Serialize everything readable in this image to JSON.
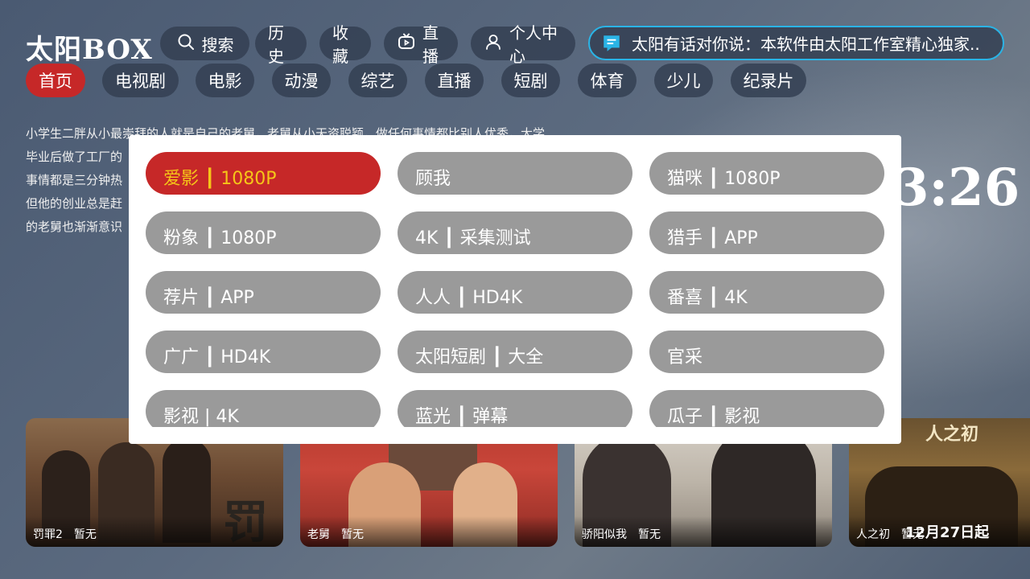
{
  "app": {
    "title": "太阳BOX"
  },
  "toolbar": {
    "search_label": "搜索",
    "history_label": "历史",
    "favorites_label": "收藏",
    "live_label": "直播",
    "profile_label": "个人中心"
  },
  "notice": {
    "text": "太阳有话对你说：本软件由太阳工作室精心独家.."
  },
  "tabs": [
    {
      "label": "首页"
    },
    {
      "label": "电视剧"
    },
    {
      "label": "电影"
    },
    {
      "label": "动漫"
    },
    {
      "label": "综艺"
    },
    {
      "label": "直播"
    },
    {
      "label": "短剧"
    },
    {
      "label": "体育"
    },
    {
      "label": "少儿"
    },
    {
      "label": "纪录片"
    }
  ],
  "description": {
    "lines": [
      "小学生二胖从小最崇拜的人就是自己的老舅，老舅从小天资聪颖，做任何事情都比别人优秀，大学",
      "毕业后做了工厂的",
      "事情都是三分钟热",
      "但他的创业总是赶",
      "的老舅也渐渐意识"
    ]
  },
  "clock": {
    "text": "3:26"
  },
  "source_dialog": {
    "items": [
      {
        "label": "爱影 ┃ 1080P"
      },
      {
        "label": "顾我"
      },
      {
        "label": "猫咪 ┃ 1080P"
      },
      {
        "label": "粉象 ┃ 1080P"
      },
      {
        "label": "4K ┃ 采集测试"
      },
      {
        "label": "猎手 ┃ APP"
      },
      {
        "label": "荐片 ┃ APP"
      },
      {
        "label": "人人 ┃ HD4K"
      },
      {
        "label": "番喜 ┃ 4K"
      },
      {
        "label": "广广 ┃ HD4K"
      },
      {
        "label": "太阳短剧 ┃ 大全"
      },
      {
        "label": "官采"
      },
      {
        "label": "影视 | 4K"
      },
      {
        "label": "蓝光 ┃ 弹幕"
      },
      {
        "label": "瓜子 ┃ 影视"
      }
    ],
    "selected_color": "#c62828",
    "selected_text_color": "#f5c518"
  },
  "cards": [
    {
      "title": "罚罪2",
      "status": "暂无"
    },
    {
      "title": "老舅",
      "status": "暂无"
    },
    {
      "title": "骄阳似我",
      "status": "暂无"
    },
    {
      "title": "人之初",
      "status": "暂无"
    }
  ],
  "poster_texts": {
    "card1_glyph": "罚",
    "card4_heading": "人之初",
    "card4_date": "12月27日起"
  },
  "colors": {
    "accent_red": "#c62828",
    "notice_border": "#2ab4e6"
  }
}
